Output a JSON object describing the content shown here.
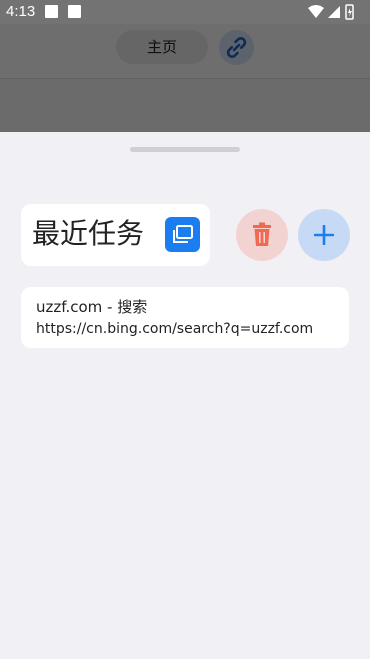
{
  "status_bar": {
    "time": "4:13"
  },
  "background_toolbar": {
    "home_tab_label": "主页",
    "link_icon": "link-icon"
  },
  "sheet": {
    "title": "最近任务",
    "title_icon": "tabs-icon",
    "delete_icon": "trash-icon",
    "add_icon": "plus-icon",
    "colors": {
      "accent_blue": "#1a7ef0",
      "delete_red": "#f06a52",
      "sheet_background": "#f1f0f5"
    },
    "tasks": [
      {
        "title": "uzzf.com - 搜索",
        "url": "https://cn.bing.com/search?q=uzzf.com"
      }
    ]
  }
}
